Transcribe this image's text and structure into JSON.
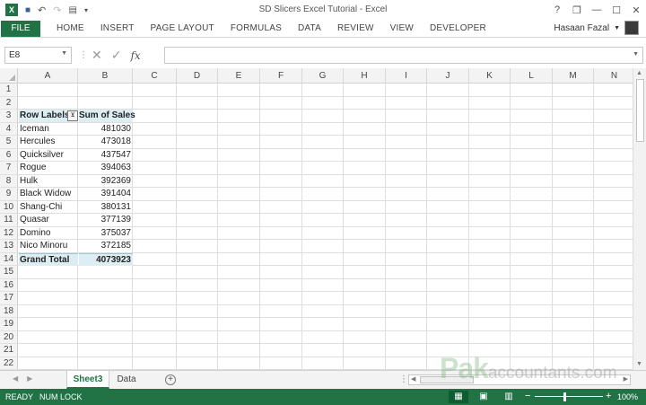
{
  "window": {
    "title": "SD Slicers Excel Tutorial - Excel",
    "help_icon": "?",
    "restore_icon": "❐",
    "min_icon": "—",
    "max_icon": "☐",
    "close_icon": "✕"
  },
  "qat": {
    "logo": "X",
    "save_icon": "💾",
    "undo_icon": "↶",
    "redo_icon": "↷",
    "customize_icon": "▾"
  },
  "ribbon": {
    "file": "FILE",
    "tabs": [
      "HOME",
      "INSERT",
      "PAGE LAYOUT",
      "FORMULAS",
      "DATA",
      "REVIEW",
      "VIEW",
      "DEVELOPER"
    ],
    "user": "Hasaan Fazal"
  },
  "formula_bar": {
    "name_box": "E8",
    "cancel_icon": "✕",
    "enter_icon": "✓",
    "fx_label": "fx",
    "formula": ""
  },
  "columns": [
    "A",
    "B",
    "C",
    "D",
    "E",
    "F",
    "G",
    "H",
    "I",
    "J",
    "K",
    "L",
    "M",
    "N"
  ],
  "rows": [
    "1",
    "2",
    "3",
    "4",
    "5",
    "6",
    "7",
    "8",
    "9",
    "10",
    "11",
    "12",
    "13",
    "14",
    "15",
    "16",
    "17",
    "18",
    "19",
    "20",
    "21",
    "22"
  ],
  "pivot": {
    "header_labels": "Row Labels",
    "header_values": "Sum of Sales",
    "filter_icon": "⊻",
    "items": [
      {
        "label": "Iceman",
        "value": "481030"
      },
      {
        "label": "Hercules",
        "value": "473018"
      },
      {
        "label": "Quicksilver",
        "value": "437547"
      },
      {
        "label": "Rogue",
        "value": "394063"
      },
      {
        "label": "Hulk",
        "value": "392369"
      },
      {
        "label": "Black Widow",
        "value": "391404"
      },
      {
        "label": "Shang-Chi",
        "value": "380131"
      },
      {
        "label": "Quasar",
        "value": "377139"
      },
      {
        "label": "Domino",
        "value": "375037"
      },
      {
        "label": "Nico Minoru",
        "value": "372185"
      }
    ],
    "total_label": "Grand Total",
    "total_value": "4073923"
  },
  "sheets": {
    "active": "Sheet3",
    "other": "Data",
    "add_icon": "+"
  },
  "watermark": {
    "brand": "Pak",
    "suffix": "accountants.com"
  },
  "status": {
    "ready": "READY",
    "numlock": "NUM LOCK",
    "zoom": "100%"
  }
}
